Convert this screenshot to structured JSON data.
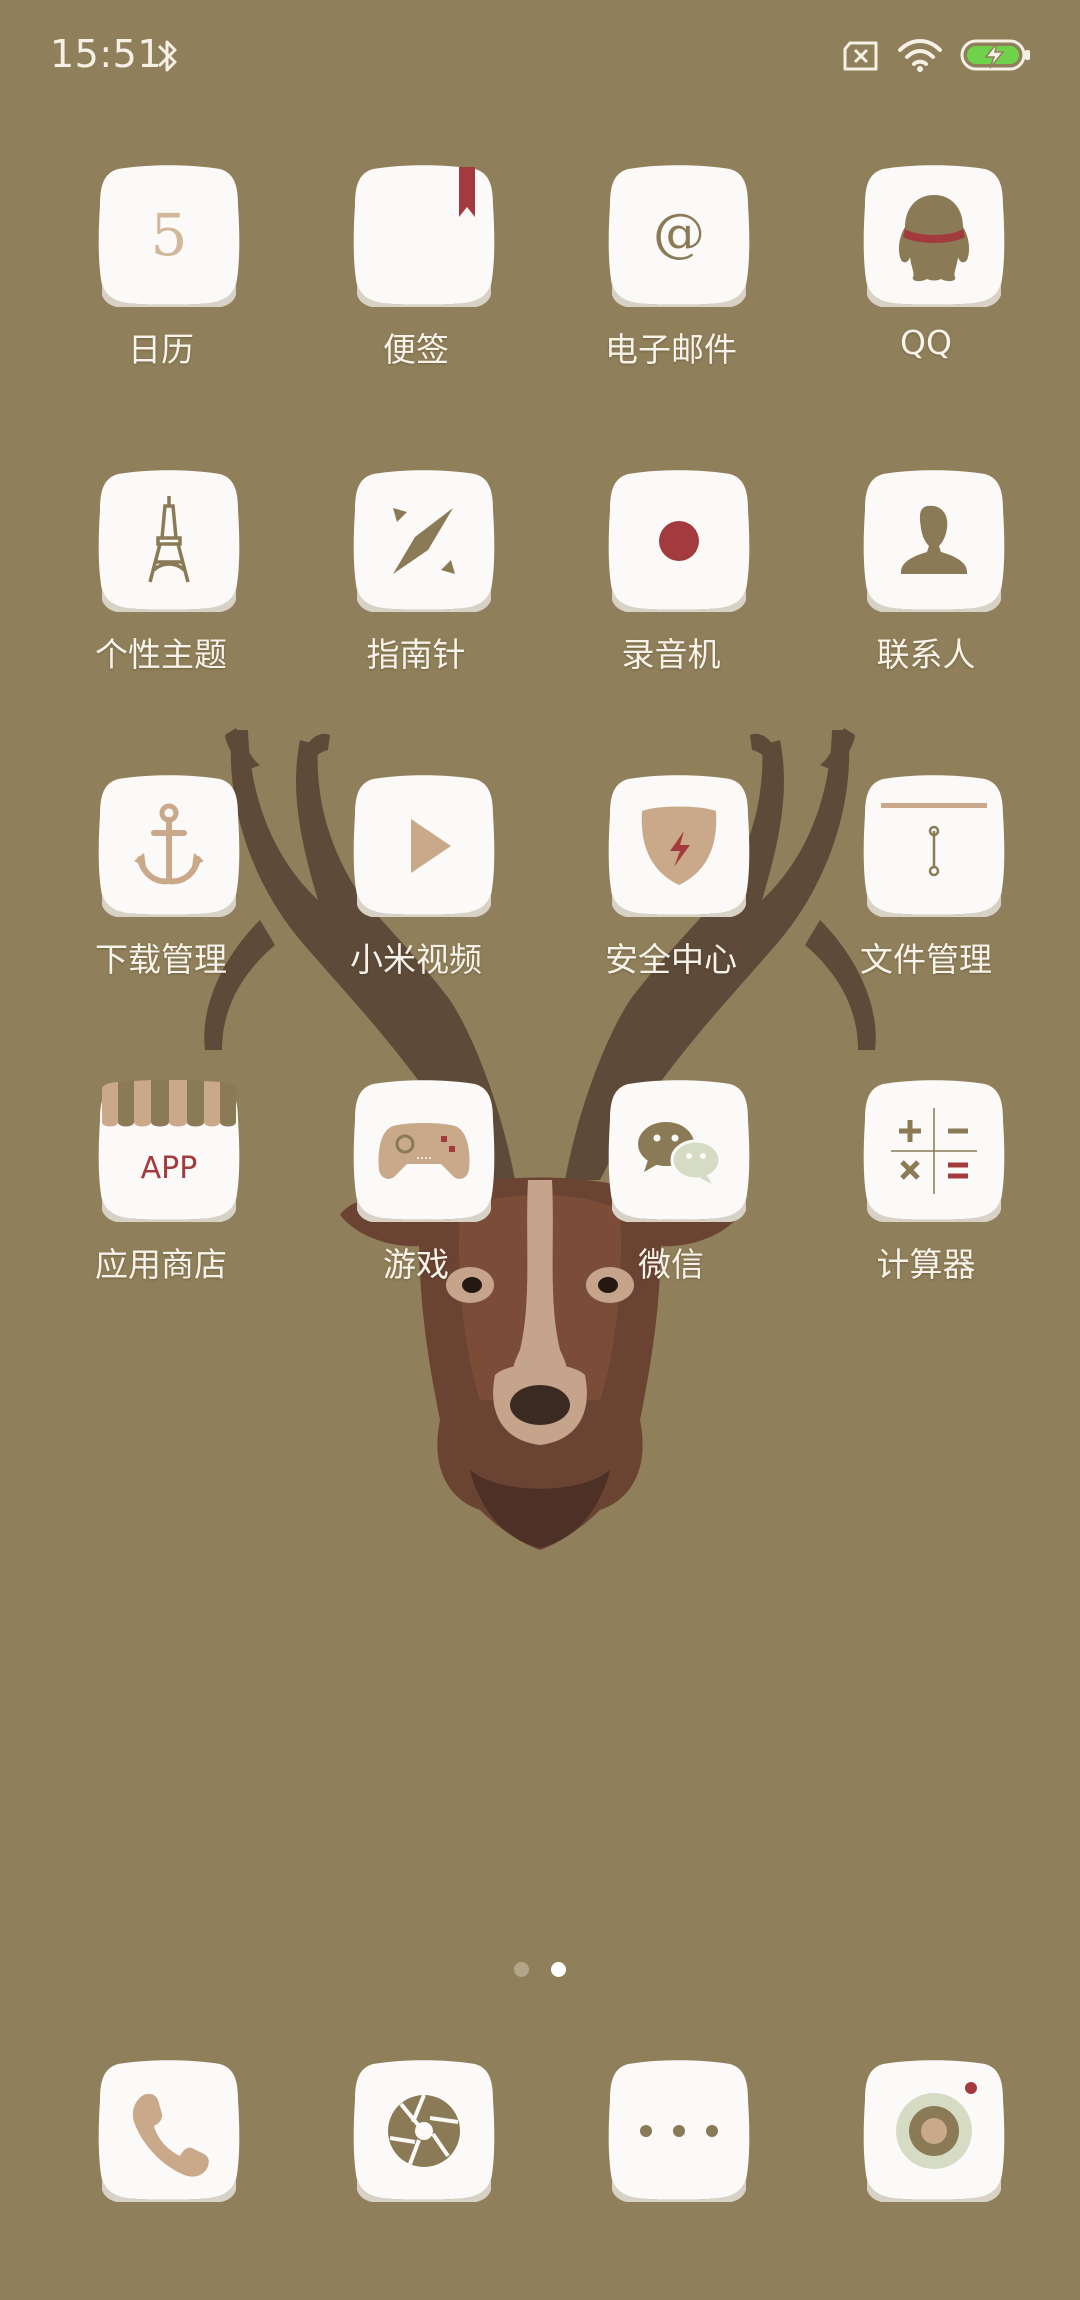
{
  "status_bar": {
    "time": "15:51",
    "icons": [
      "bluetooth-icon",
      "sim-card-missing-icon",
      "wifi-icon",
      "battery-charging-icon"
    ],
    "battery_color": "#6fd24a"
  },
  "home": {
    "apps": [
      {
        "label": "日历",
        "icon": "calendar-icon",
        "glyph_text": "5"
      },
      {
        "label": "便签",
        "icon": "notes-icon"
      },
      {
        "label": "电子邮件",
        "icon": "email-icon",
        "glyph_text": "@"
      },
      {
        "label": "QQ",
        "icon": "qq-penguin-icon"
      },
      {
        "label": "个性主题",
        "icon": "eiffel-tower-themes-icon"
      },
      {
        "label": "指南针",
        "icon": "compass-icon"
      },
      {
        "label": "录音机",
        "icon": "recorder-icon"
      },
      {
        "label": "联系人",
        "icon": "contacts-person-icon"
      },
      {
        "label": "下载管理",
        "icon": "anchor-download-icon"
      },
      {
        "label": "小米视频",
        "icon": "play-video-icon"
      },
      {
        "label": "安全中心",
        "icon": "shield-security-icon"
      },
      {
        "label": "文件管理",
        "icon": "file-manager-icon"
      },
      {
        "label": "应用商店",
        "icon": "app-store-awning-icon",
        "glyph_text": "APP"
      },
      {
        "label": "游戏",
        "icon": "gamepad-icon"
      },
      {
        "label": "微信",
        "icon": "wechat-bubbles-icon"
      },
      {
        "label": "计算器",
        "icon": "calculator-icon"
      }
    ],
    "page_indicator": {
      "pages": 2,
      "current": 2
    }
  },
  "dock": {
    "apps": [
      {
        "icon": "phone-icon"
      },
      {
        "icon": "camera-aperture-icon"
      },
      {
        "icon": "more-dots-icon"
      },
      {
        "icon": "camera-lens-icon"
      }
    ]
  },
  "colors": {
    "wallpaper": "#8f7f5a",
    "accent_red": "#a33a3d",
    "icon_tile": "#fbfaf8",
    "icon_tan": "#c9a98a"
  }
}
